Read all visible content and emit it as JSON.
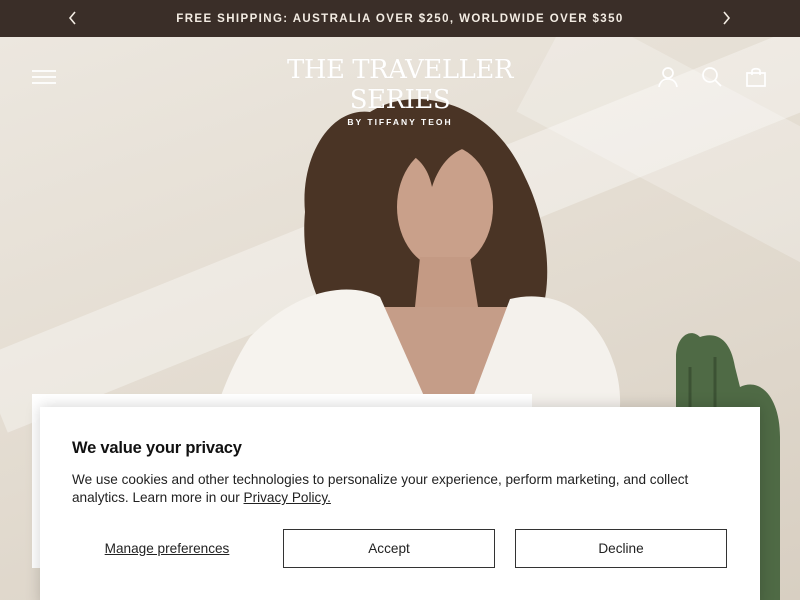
{
  "announcement": {
    "message": "FREE SHIPPING: AUSTRALIA OVER $250, WORLDWIDE OVER $350",
    "prev_icon": "chevron-left-icon",
    "next_icon": "chevron-right-icon"
  },
  "header": {
    "logo_title": "THE TRAVELLER SERIES",
    "logo_subtitle": "BY TIFFANY TEOH",
    "icons": [
      "hamburger-menu-icon",
      "account-icon",
      "search-icon",
      "shopping-bag-icon"
    ]
  },
  "cookie_banner": {
    "title": "We value your privacy",
    "body": "We use cookies and other technologies to personalize your experience, perform marketing, and collect analytics. Learn more in our ",
    "link_label": "Privacy Policy.",
    "manage_label": "Manage preferences",
    "accept_label": "Accept",
    "decline_label": "Decline"
  },
  "colors": {
    "announcement_bg": "#3a2e28",
    "announcement_text": "#f3ece3",
    "hero_bg": "#e9e4dc",
    "button_border": "#333333"
  }
}
